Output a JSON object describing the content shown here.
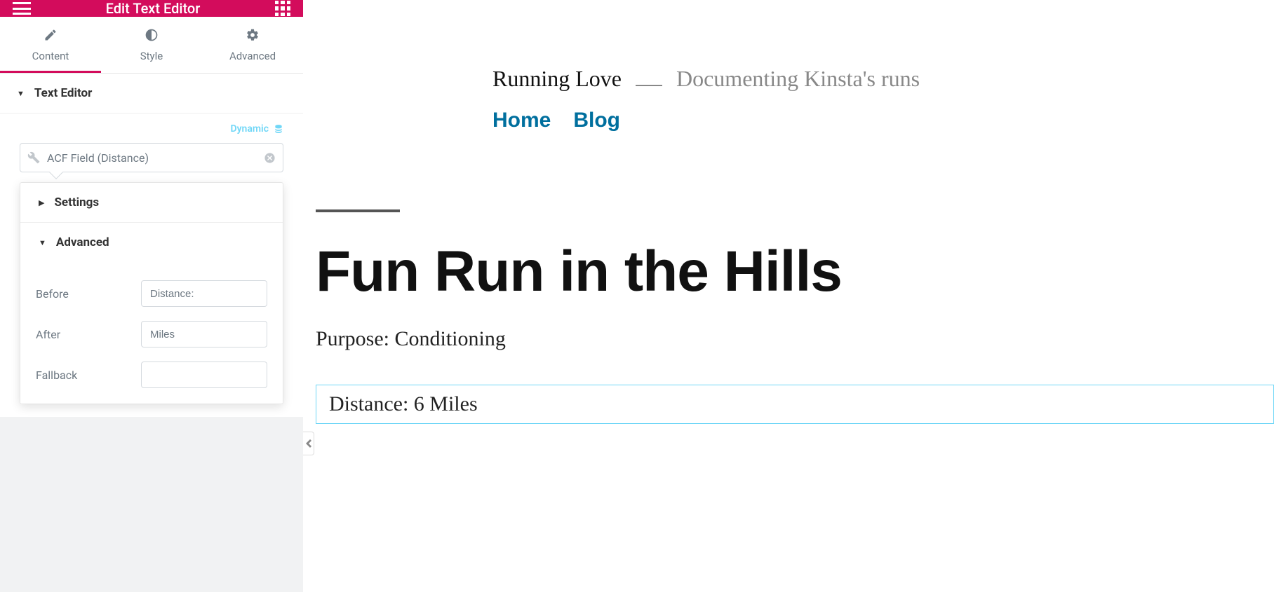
{
  "sidebar": {
    "title": "Edit Text Editor",
    "tabs": [
      {
        "label": "Content",
        "active": true
      },
      {
        "label": "Style",
        "active": false
      },
      {
        "label": "Advanced",
        "active": false
      }
    ]
  },
  "section": {
    "text_editor_label": "Text Editor",
    "dynamic_label": "Dynamic",
    "field_value": "ACF Field (Distance)"
  },
  "popover": {
    "settings_label": "Settings",
    "advanced_label": "Advanced",
    "before": {
      "label": "Before",
      "value": "Distance:"
    },
    "after": {
      "label": "After",
      "value": "Miles"
    },
    "fallback": {
      "label": "Fallback",
      "value": ""
    }
  },
  "preview": {
    "site_title": "Running Love",
    "tagline": "Documenting Kinsta's runs",
    "nav": {
      "home": "Home",
      "blog": "Blog"
    },
    "post_title": "Fun Run in the Hills",
    "purpose": "Purpose: Conditioning",
    "distance": "Distance: 6 Miles"
  }
}
